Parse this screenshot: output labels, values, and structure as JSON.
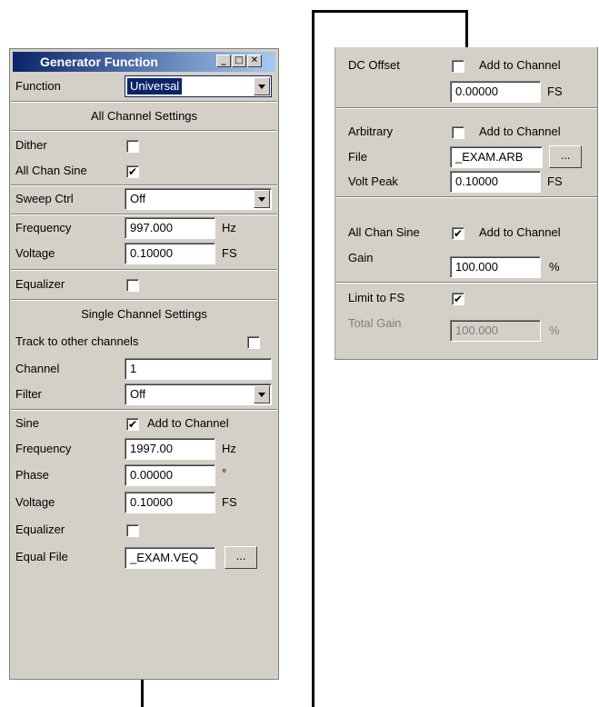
{
  "left": {
    "title": "Generator Function",
    "function_label": "Function",
    "function_value": "Universal",
    "all_channel_header": "All Channel Settings",
    "dither_label": "Dither",
    "all_chan_sine_label": "All Chan Sine",
    "sweep_ctrl_label": "Sweep Ctrl",
    "sweep_ctrl_value": "Off",
    "frequency_label": "Frequency",
    "frequency_value": "997.000",
    "frequency_unit": "Hz",
    "voltage_label": "Voltage",
    "voltage_value": "0.10000",
    "voltage_unit": "FS",
    "equalizer_label": "Equalizer",
    "single_channel_header": "Single Channel Settings",
    "track_label": "Track to other channels",
    "channel_label": "Channel",
    "channel_value": "1",
    "filter_label": "Filter",
    "filter_value": "Off",
    "sine_label": "Sine",
    "add_to_channel": "Add to Channel",
    "sine_frequency_label": "Frequency",
    "sine_frequency_value": "1997.00",
    "sine_frequency_unit": "Hz",
    "phase_label": "Phase",
    "phase_value": "0.00000",
    "phase_unit": "°",
    "sine_voltage_label": "Voltage",
    "sine_voltage_value": "0.10000",
    "sine_voltage_unit": "FS",
    "sine_equalizer_label": "Equalizer",
    "equal_file_label": "Equal File",
    "equal_file_value": "_EXAM.VEQ",
    "browse": "..."
  },
  "right": {
    "dc_offset_label": "DC Offset",
    "dc_add_to_channel": "Add to Channel",
    "dc_value": "0.00000",
    "dc_unit": "FS",
    "arbitrary_label": "Arbitrary",
    "arb_add_to_channel": "Add to Channel",
    "file_label": "File",
    "file_value": "_EXAM.ARB",
    "browse": "...",
    "volt_peak_label": "Volt Peak",
    "volt_peak_value": "0.10000",
    "volt_peak_unit": "FS",
    "all_chan_sine_label": "All Chan Sine",
    "acs_add_to_channel": "Add to Channel",
    "gain_label": "Gain",
    "gain_value": "100.000",
    "gain_unit": "%",
    "limit_label": "Limit to FS",
    "total_gain_label": "Total Gain",
    "total_gain_value": "100.000",
    "total_gain_unit": "%"
  },
  "checkboxes": {
    "dither": false,
    "all_chan_sine": true,
    "equalizer": false,
    "track": false,
    "sine": true,
    "sine_equalizer": false,
    "dc_offset": false,
    "arbitrary": false,
    "right_all_chan_sine": true,
    "limit_to_fs": true
  },
  "check_mark": "✔",
  "icons": {
    "minimize": "minimize-icon",
    "maximize": "maximize-icon",
    "close": "close-icon"
  }
}
